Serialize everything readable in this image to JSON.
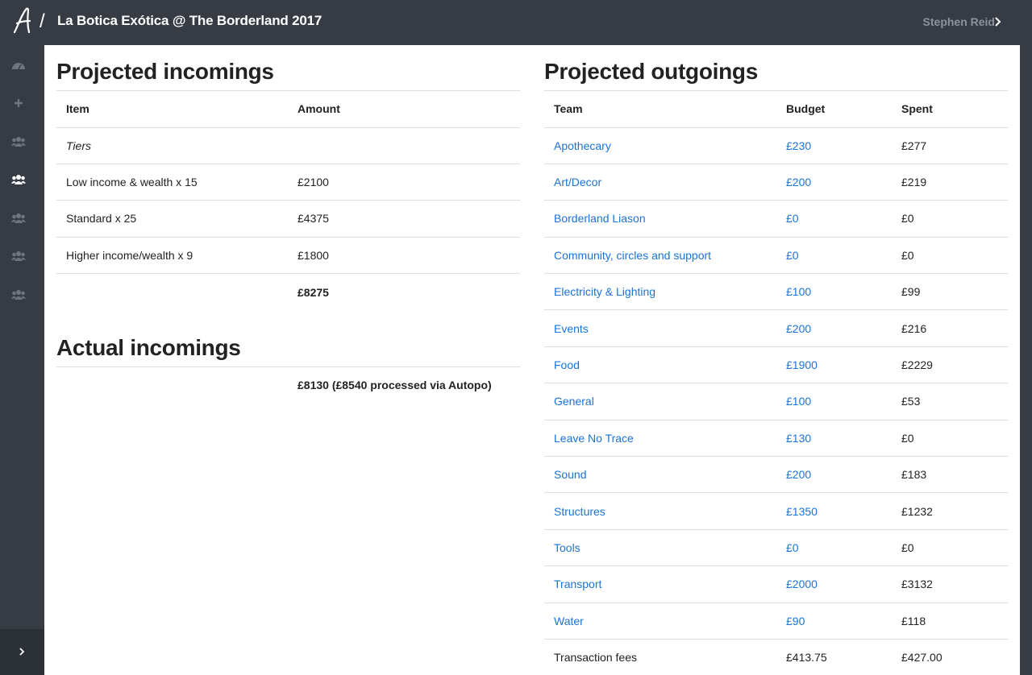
{
  "header": {
    "title": "La Botica Exótica @ The Borderland 2017",
    "user": "Stephen Reid"
  },
  "sidebar": {
    "icons": [
      "dashboard-icon",
      "plus-icon",
      "group-icon",
      "group-icon",
      "group-icon",
      "group-icon",
      "group-icon"
    ],
    "toggle_icon": "chevron-right-icon"
  },
  "projected_incomings": {
    "title": "Projected incomings",
    "headers": [
      "Item",
      "Amount"
    ],
    "rows": [
      {
        "item": "Tiers",
        "amount": ""
      },
      {
        "item": "Low income & wealth x 15",
        "amount": "£2100"
      },
      {
        "item": "Standard x 25",
        "amount": "£4375"
      },
      {
        "item": "Higher income/wealth x 9",
        "amount": "£1800"
      },
      {
        "item": "",
        "amount": "£8275"
      }
    ]
  },
  "actual_incomings": {
    "title": "Actual incomings",
    "value": "£8130 (£8540 processed via Autopo)"
  },
  "projected_outgoings": {
    "title": "Projected outgoings",
    "headers": [
      "Team",
      "Budget",
      "Spent"
    ],
    "rows": [
      {
        "team": "Apothecary",
        "budget": "£230",
        "spent": "£277"
      },
      {
        "team": "Art/Decor",
        "budget": "£200",
        "spent": "£219"
      },
      {
        "team": "Borderland Liason",
        "budget": "£0",
        "spent": "£0"
      },
      {
        "team": "Community, circles and support",
        "budget": "£0",
        "spent": "£0"
      },
      {
        "team": "Electricity & Lighting",
        "budget": "£100",
        "spent": "£99"
      },
      {
        "team": "Events",
        "budget": "£200",
        "spent": "£216"
      },
      {
        "team": "Food",
        "budget": "£1900",
        "spent": "£2229"
      },
      {
        "team": "General",
        "budget": "£100",
        "spent": "£53"
      },
      {
        "team": "Leave No Trace",
        "budget": "£130",
        "spent": "£0"
      },
      {
        "team": "Sound",
        "budget": "£200",
        "spent": "£183"
      },
      {
        "team": "Structures",
        "budget": "£1350",
        "spent": "£1232"
      },
      {
        "team": "Tools",
        "budget": "£0",
        "spent": "£0"
      },
      {
        "team": "Transport",
        "budget": "£2000",
        "spent": "£3132"
      },
      {
        "team": "Water",
        "budget": "£90",
        "spent": "£118"
      }
    ],
    "fees": {
      "team": "Transaction fees",
      "budget": "£413.75",
      "spent": "£427.00"
    }
  },
  "colors": {
    "chrome": "#363b44",
    "link": "#1a73d9",
    "border": "#dddddd"
  }
}
